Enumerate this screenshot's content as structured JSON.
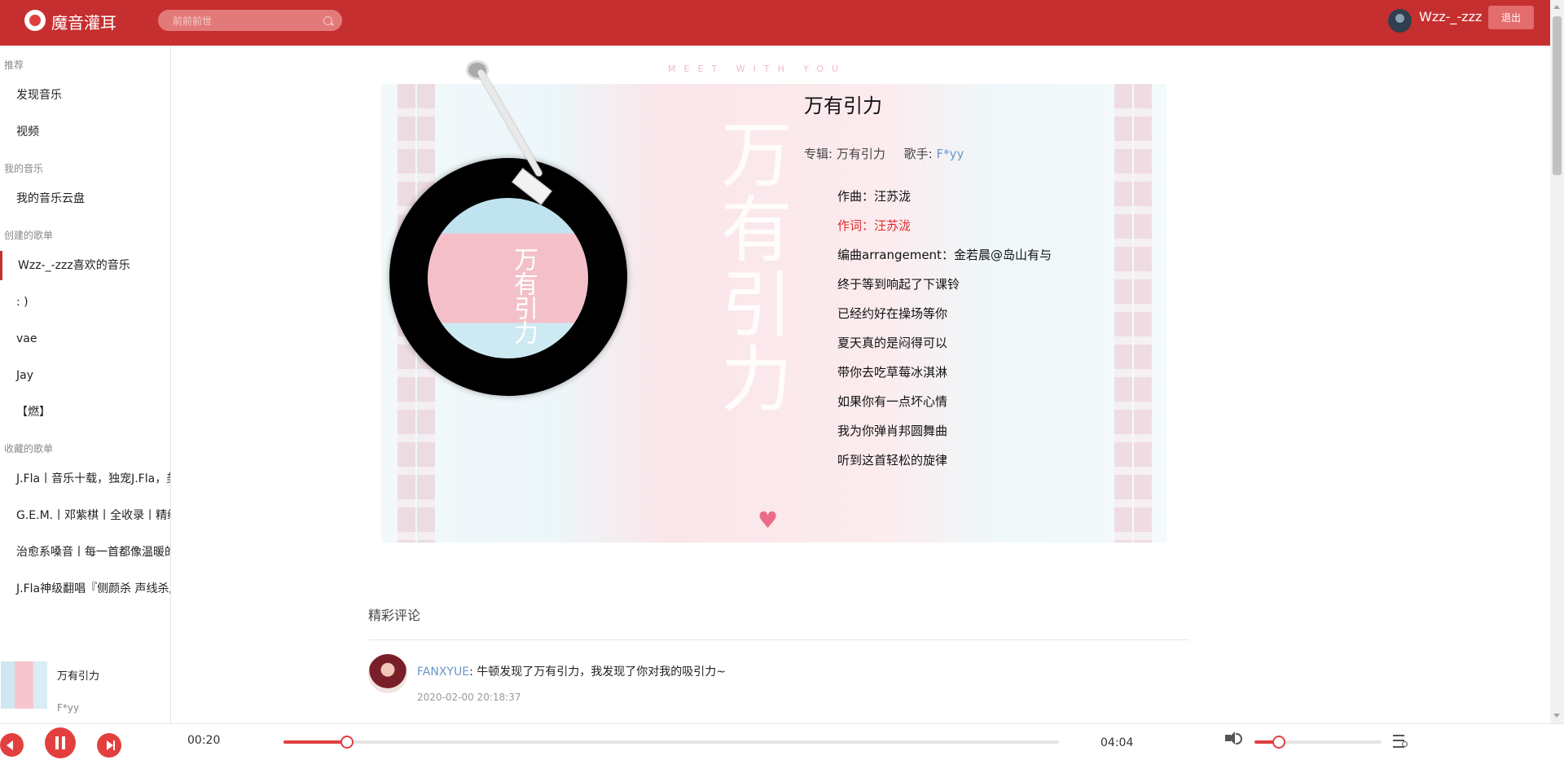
{
  "app": {
    "title": "魔音灌耳"
  },
  "search": {
    "placeholder": "前前前世"
  },
  "user": {
    "name": "Wzz-_-zzz",
    "logout_label": "退出"
  },
  "sidebar": {
    "sections": [
      {
        "title": "推荐",
        "items": [
          "发现音乐",
          "视频"
        ]
      },
      {
        "title": "我的音乐",
        "items": [
          "我的音乐云盘"
        ]
      },
      {
        "title": "创建的歌单",
        "items": [
          "Wzz-_-zzz喜欢的音乐",
          ": )",
          "vae",
          "Jay",
          "【燃】"
        ]
      },
      {
        "title": "收藏的歌单",
        "items": [
          "J.Fla丨音乐十载，独宠J.Fla，美",
          "G.E.M.丨邓紫棋丨全收录丨精编",
          "治愈系嗓音丨每一首都像温暖的",
          "J.Fla神级翻唱『侧颜杀 声线杀』"
        ]
      }
    ],
    "active_item": "Wzz-_-zzz喜欢的音乐"
  },
  "now_playing": {
    "title": "万有引力",
    "artist": "F*yy"
  },
  "song": {
    "title": "万有引力",
    "album_label": "专辑:",
    "album": "万有引力",
    "artist_label": "歌手:",
    "artist": "F*yy",
    "art_big_chars": [
      "万",
      "有",
      "引",
      "力"
    ],
    "art_tagline": "MEET WITH YOU",
    "disc_title": "万有引力"
  },
  "lyrics": {
    "lines": [
      "作曲：汪苏泷",
      "作词：汪苏泷",
      "编曲arrangement：金若晨@岛山有与",
      "终于等到响起了下课铃",
      "已经约好在操场等你",
      "夏天真的是闷得可以",
      "带你去吃草莓冰淇淋",
      "如果你有一点坏心情",
      "我为你弹肖邦圆舞曲",
      "听到这首轻松的旋律"
    ],
    "current_index": 1
  },
  "comments": {
    "heading": "精彩评论",
    "items": [
      {
        "user": "FANXYUE",
        "text": ": 牛顿发现了万有引力，我发现了你对我的吸引力~",
        "time": "2020-02-00 20:18:37"
      }
    ]
  },
  "player": {
    "current_time": "00:20",
    "total_time": "04:04",
    "progress": 0.0815,
    "volume": 0.19
  },
  "colors": {
    "brand": "#c62f2f",
    "accent": "#e43f3f",
    "link": "#6a96c8",
    "current_lyric": "#e02d2d"
  }
}
